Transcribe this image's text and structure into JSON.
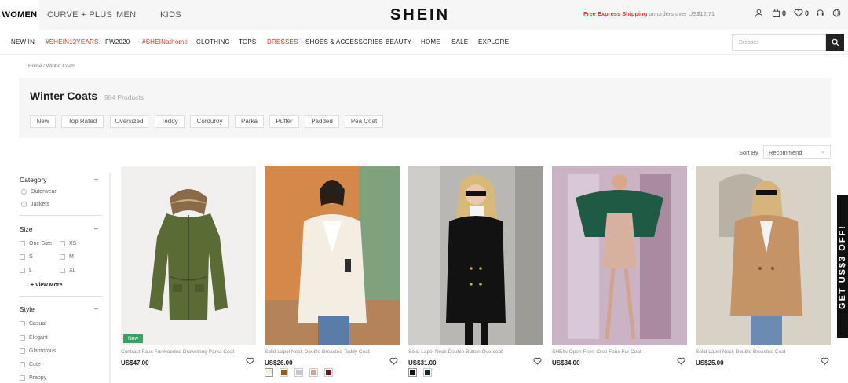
{
  "top_tabs": [
    "WOMEN",
    "CURVE + PLUS",
    "MEN",
    "KIDS"
  ],
  "logo": "SHEIN",
  "promo": {
    "highlight": "Free Express Shipping",
    "rest": " on orders over US$12.71"
  },
  "header_icons": {
    "bag_count": "0",
    "wishlist_count": "0"
  },
  "nav": [
    "NEW IN",
    "#SHEIN12YEARS",
    "FW2020",
    "#SHEINathome",
    "CLOTHING",
    "TOPS",
    "DRESSES",
    "SHOES & ACCESSORIES",
    "BEAUTY",
    "HOME",
    "SALE",
    "EXPLORE"
  ],
  "search": {
    "placeholder": "Dresses"
  },
  "breadcrumb": "Home / Winter Coats",
  "page": {
    "title": "Winter Coats",
    "count": "984 Products"
  },
  "chips": [
    "New",
    "Top Rated",
    "Oversized",
    "Teddy",
    "Corduroy",
    "Parka",
    "Puffer",
    "Padded",
    "Pea Coat"
  ],
  "sort": {
    "label": "Sort By",
    "value": "Recommend"
  },
  "filters": {
    "category": {
      "title": "Category",
      "options": [
        "Outerwear",
        "Jackets"
      ]
    },
    "size": {
      "title": "Size",
      "options": [
        "One-Size",
        "XS",
        "S",
        "M",
        "L",
        "XL"
      ],
      "more": "+ View More"
    },
    "style": {
      "title": "Style",
      "options": [
        "Casual",
        "Elegant",
        "Glamorous",
        "Cute",
        "Preppy"
      ]
    }
  },
  "products": [
    {
      "name": "Contrast Faux Fur Hooded Drawstring Parka Coat",
      "price": "US$47.00",
      "badge": "New"
    },
    {
      "name": "Solid Lapel Neck Double Breasted Teddy Coat",
      "price": "US$26.00"
    },
    {
      "name": "Solid Lapel Neck Double Button Overcoat",
      "price": "US$31.00"
    },
    {
      "name": "SHEIN Open Front Crop Faux Fur Coat",
      "price": "US$34.00"
    },
    {
      "name": "Solid Lapel Neck Double Breasted Coat",
      "price": "US$25.00"
    }
  ],
  "side_promo": "GET US$3 OFF!",
  "colors": {
    "accent_red": "#e4322c",
    "new_badge": "#3da063"
  }
}
